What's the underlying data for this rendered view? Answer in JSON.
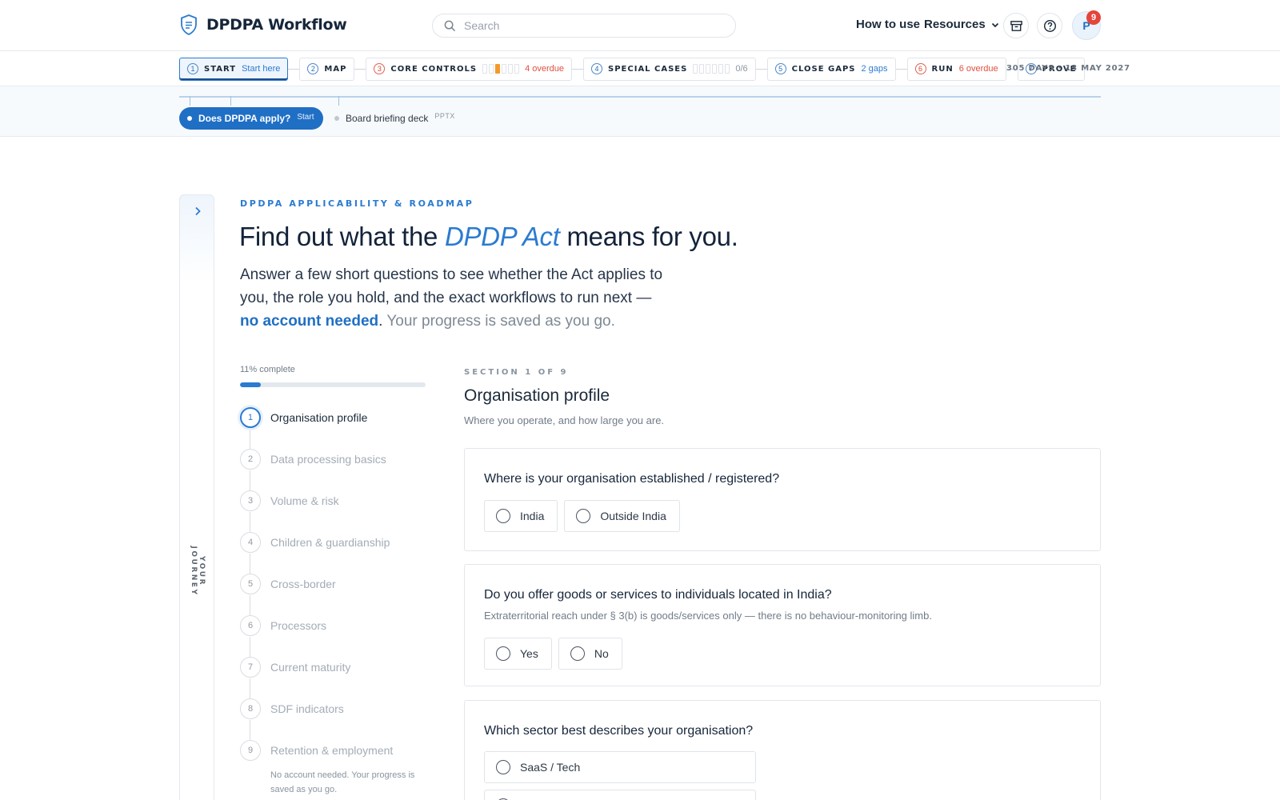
{
  "app": {
    "title": "DPDPA Workflow",
    "icons": {
      "logo": "shield-icon",
      "search": "search-icon",
      "archive": "archive-icon",
      "help": "help-circle-icon",
      "chevron": "chevron-down-icon"
    }
  },
  "header": {
    "search_placeholder": "Search",
    "how_to_use": "How to use",
    "resources": "Resources",
    "avatar_initial": "P",
    "notification_count": "9"
  },
  "stepper": {
    "steps": [
      {
        "num": "1",
        "label": "START",
        "sub": "Start here",
        "status": "active"
      },
      {
        "num": "2",
        "label": "MAP",
        "sub": "",
        "status": "normal"
      },
      {
        "num": "3",
        "label": "CORE CONTROLS",
        "sub": "4 overdue",
        "status": "overdue",
        "progress_of_8": 1
      },
      {
        "num": "4",
        "label": "SPECIAL CASES",
        "sub": "0/6",
        "status": "normal",
        "progress_of_6": 0
      },
      {
        "num": "5",
        "label": "CLOSE GAPS",
        "sub": "2 gaps",
        "status": "normal"
      },
      {
        "num": "6",
        "label": "RUN",
        "sub": "6 overdue",
        "status": "overdue"
      },
      {
        "num": "7",
        "label": "PROVE",
        "sub": "",
        "status": "normal"
      }
    ],
    "deadline": "305 DAYS · 13 MAY 2027"
  },
  "substrip": {
    "pill_label": "Does DPDPA apply?",
    "pill_sub": "Start",
    "deck_label": "Board briefing deck",
    "deck_tag": "PPTX"
  },
  "rail": {
    "label": "YOUR JOURNEY"
  },
  "hero": {
    "eyebrow": "DPDPA APPLICABILITY & ROADMAP",
    "title_pre": "Find out what the ",
    "title_accent": "DPDP Act",
    "title_post": " means for you.",
    "desc_main": "Answer a few short questions to see whether the Act applies to you, the role you hold, and the exact workflows to run next — ",
    "desc_strong": "no account needed",
    "desc_dot": ".",
    "desc_muted": " Your progress is saved as you go."
  },
  "progress": {
    "label": "11% complete",
    "fraction": 0.11
  },
  "sections": [
    {
      "num": "1",
      "name": "Organisation profile",
      "active": true
    },
    {
      "num": "2",
      "name": "Data processing basics",
      "active": false
    },
    {
      "num": "3",
      "name": "Volume & risk",
      "active": false
    },
    {
      "num": "4",
      "name": "Children & guardianship",
      "active": false
    },
    {
      "num": "5",
      "name": "Cross-border",
      "active": false
    },
    {
      "num": "6",
      "name": "Processors",
      "active": false
    },
    {
      "num": "7",
      "name": "Current maturity",
      "active": false
    },
    {
      "num": "8",
      "name": "SDF indicators",
      "active": false
    },
    {
      "num": "9",
      "name": "Retention & employment",
      "active": false
    }
  ],
  "sections_note": "No account needed. Your progress is saved as you go.",
  "form": {
    "eyebrow": "SECTION 1 OF 9",
    "title": "Organisation profile",
    "desc": "Where you operate, and how large you are.",
    "questions": [
      {
        "text": "Where is your organisation established / registered?",
        "help": "",
        "options": [
          "India",
          "Outside India"
        ]
      },
      {
        "text": "Do you offer goods or services to individuals located in India?",
        "help": "Extraterritorial reach under § 3(b) is goods/services only — there is no behaviour-monitoring limb.",
        "options": [
          "Yes",
          "No"
        ]
      },
      {
        "text": "Which sector best describes your organisation?",
        "help": "",
        "options": [
          "SaaS / Tech"
        ]
      }
    ]
  },
  "colors": {
    "accent": "#2b7bd0",
    "overdue": "#e0503f",
    "badge": "#e5443a",
    "progress_seg": "#f39a2b"
  }
}
